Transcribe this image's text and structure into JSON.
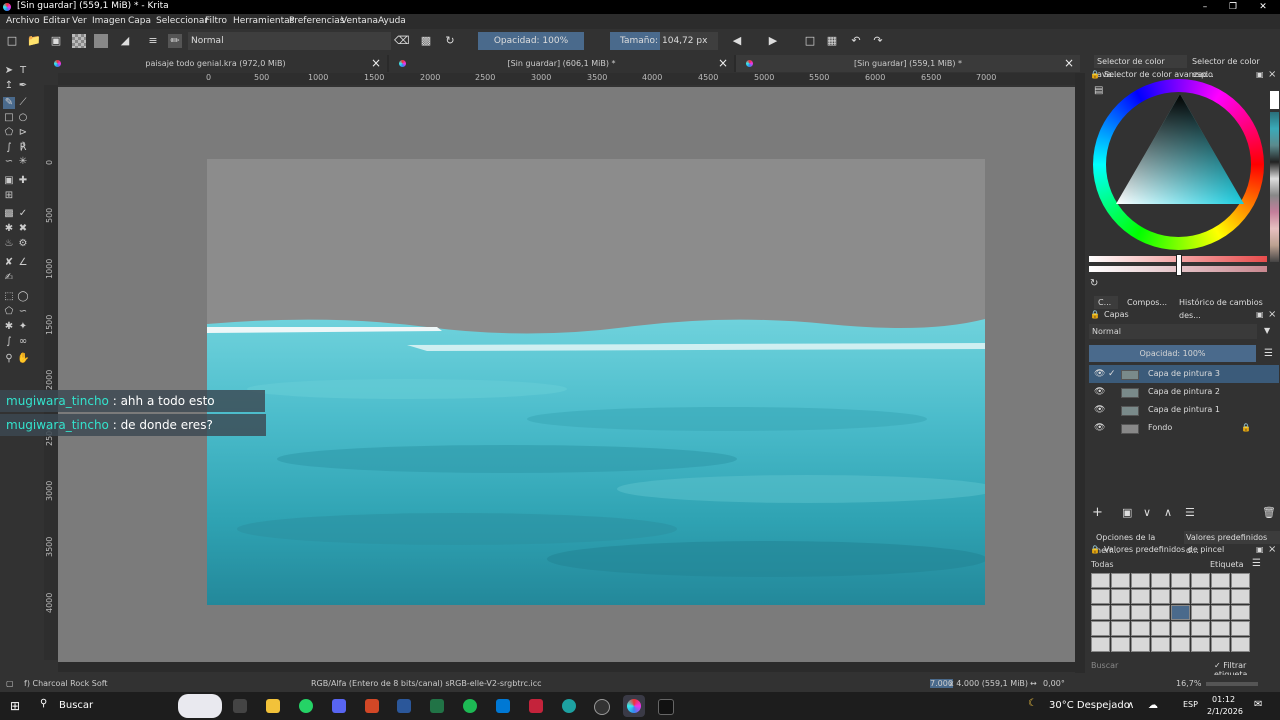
{
  "window": {
    "title": "[Sin guardar]  (559,1 MiB) * - Krita"
  },
  "menu": [
    "Archivo",
    "Editar",
    "Ver",
    "Imagen",
    "Capa",
    "Seleccionar",
    "Filtro",
    "Herramientas",
    "Preferencias",
    "Ventana",
    "Ayuda"
  ],
  "toolbar": {
    "blend_mode": "Normal",
    "opacity": "Opacidad: 100%",
    "size_label": "Tamaño:",
    "size_value": "104,72 px"
  },
  "tabs": [
    {
      "label": "paisaje todo genial.kra (972,0 MiB)"
    },
    {
      "label": "[Sin guardar]  (606,1 MiB) *"
    },
    {
      "label": "[Sin guardar]  (559,1 MiB) *"
    }
  ],
  "ruler": {
    "h_ticks": [
      "0",
      "500",
      "1000",
      "1500",
      "2000",
      "2500",
      "3000",
      "3500",
      "4000",
      "4500",
      "5000",
      "5500",
      "6000",
      "6500",
      "7000"
    ],
    "v_ticks": [
      "0",
      "500",
      "1000",
      "1500",
      "2000",
      "2500",
      "3000",
      "3500",
      "4000"
    ]
  },
  "chat": [
    {
      "user": "mugiwara_tincho",
      "message": " : ahh a todo esto"
    },
    {
      "user": "mugiwara_tincho",
      "message": " : de donde eres?"
    }
  ],
  "docker": {
    "top_tabs": [
      "Selector de color ava...",
      "Selector de color esp..."
    ],
    "color_title": "Selector de color avanzado",
    "mid_tabs": [
      "C...",
      "Compos...",
      "Histórico de cambios des..."
    ],
    "layers_title": "Capas",
    "layers_blend": "Normal",
    "layers_opacity": "Opacidad:  100%",
    "layers": [
      "Capa de pintura 3",
      "Capa de pintura 2",
      "Capa de pintura 1",
      "Fondo"
    ],
    "bottom_tabs": [
      "Opciones de la herr...",
      "Valores predefinidos d..."
    ],
    "presets_title": "Valores predefinidos de pincel",
    "presets_filter": "Todas",
    "presets_tag": "Etiqueta",
    "search_placeholder": "Buscar",
    "filter_tag": "Filtrar etiqueta"
  },
  "status": {
    "brush": "f) Charcoal Rock Soft",
    "color_space": "RGB/Alfa (Entero de 8 bits/canal)  sRGB-elle-V2-srgbtrc.icc",
    "dims_sel": "7.000",
    "dims": " x 4.000 (559,1 MiB)",
    "rotation": "0,00°",
    "zoom": "16,7%"
  },
  "taskbar": {
    "search": "Buscar",
    "weather": "30°C  Despejado",
    "lang": "ESP",
    "time": "01:12",
    "date": "2/1/2026"
  },
  "colors": {
    "accent": "#3b5b7a",
    "chat_name": "#33e3cd",
    "sea": "#2e9fb0"
  }
}
